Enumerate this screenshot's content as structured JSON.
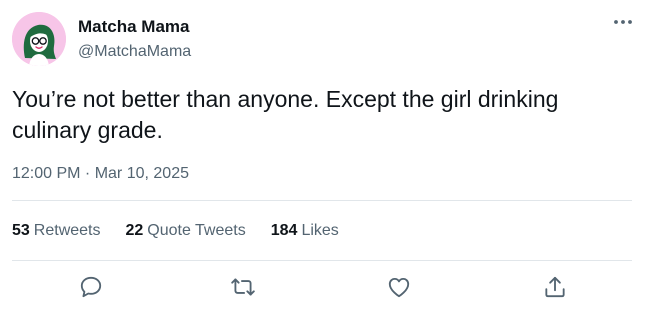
{
  "author": {
    "display_name": "Matcha Mama",
    "handle": "@MatchaMama",
    "avatar_icon": "illustrated-woman-avatar",
    "avatar_bg": "#f7c5e8"
  },
  "tweet": {
    "text": "You’re not better than anyone. Except the girl drinking culinary grade.",
    "timestamp": "12:00 PM · Mar 10, 2025"
  },
  "stats": [
    {
      "count": "53",
      "label": "Retweets"
    },
    {
      "count": "22",
      "label": "Quote Tweets"
    },
    {
      "count": "184",
      "label": "Likes"
    }
  ],
  "actions": [
    {
      "icon": "reply-icon"
    },
    {
      "icon": "retweet-icon"
    },
    {
      "icon": "like-icon"
    },
    {
      "icon": "share-icon"
    }
  ],
  "colors": {
    "text_primary": "#0f1419",
    "text_secondary": "#536471",
    "divider": "#e1e6ea"
  }
}
